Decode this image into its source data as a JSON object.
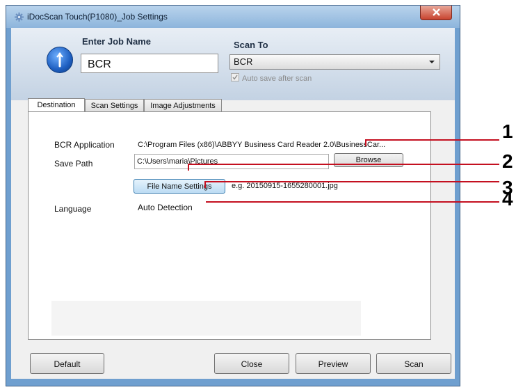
{
  "window": {
    "title": "iDocScan Touch(P1080)_Job Settings"
  },
  "header": {
    "enter_job_name_label": "Enter Job Name",
    "job_name_value": "BCR",
    "scan_to_label": "Scan To",
    "scan_to_value": "BCR",
    "auto_save_label": "Auto save after scan",
    "auto_save_checked": true
  },
  "tabs": [
    {
      "label": "Destination",
      "active": true
    },
    {
      "label": "Scan Settings",
      "active": false
    },
    {
      "label": "Image Adjustments",
      "active": false
    }
  ],
  "destination": {
    "bcr_application_label": "BCR Application",
    "bcr_application_value": "C:\\Program Files (x86)\\ABBYY Business Card Reader 2.0\\BusinessCar...",
    "save_path_label": "Save Path",
    "save_path_value": "C:\\Users\\maria\\Pictures",
    "browse_label": "Browse",
    "file_name_settings_label": "File Name Settings",
    "file_name_example": "e.g. 20150915-1655280001.jpg",
    "language_label": "Language",
    "language_value": "Auto Detection"
  },
  "footer": {
    "default_label": "Default",
    "close_label": "Close",
    "preview_label": "Preview",
    "scan_label": "Scan"
  },
  "callouts": [
    "1",
    "2",
    "3",
    "4"
  ],
  "colors": {
    "callout_red": "#c41020",
    "window_frame": "#6f9fcf",
    "active_button_blue": "#bcdcf4"
  }
}
